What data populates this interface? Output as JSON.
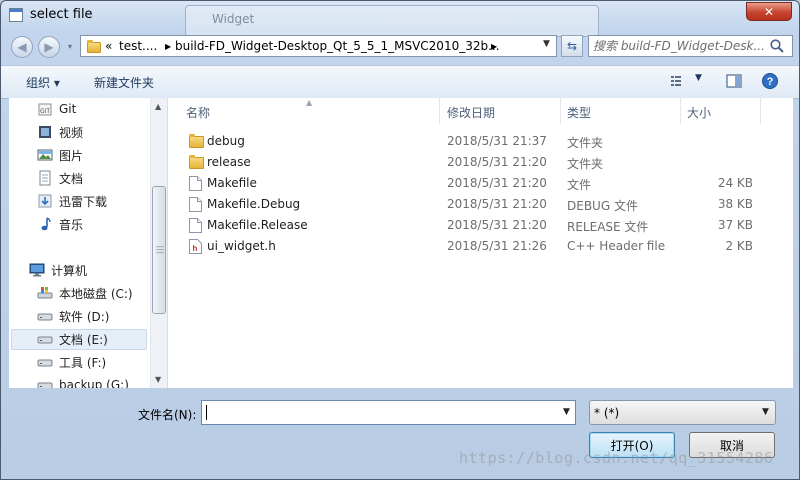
{
  "window": {
    "title": "select file",
    "background_window_title": "Widget"
  },
  "nav_buttons": {
    "back_glyph": "◀",
    "forward_glyph": "▶",
    "recent_glyph": "▾"
  },
  "address": {
    "prefix": "«",
    "crumbs": [
      {
        "label": "test...."
      },
      {
        "label": "build-FD_Widget-Desktop_Qt_5_5_1_MSVC2010_32b..."
      }
    ],
    "separator": "▶"
  },
  "search": {
    "placeholder": "搜索 build-FD_Widget-Desk..."
  },
  "toolbar": {
    "organize_label": "组织 ▾",
    "new_folder_label": "新建文件夹"
  },
  "sidebar": {
    "items": [
      {
        "label": "Git",
        "icon": "git-folder-icon"
      },
      {
        "label": "视频",
        "icon": "video-library-icon"
      },
      {
        "label": "图片",
        "icon": "picture-library-icon"
      },
      {
        "label": "文档",
        "icon": "document-library-icon"
      },
      {
        "label": "迅雷下载",
        "icon": "download-folder-icon"
      },
      {
        "label": "音乐",
        "icon": "music-library-icon"
      },
      {
        "label": "计算机",
        "icon": "computer-icon"
      },
      {
        "label": "本地磁盘 (C:)",
        "icon": "system-drive-icon"
      },
      {
        "label": "软件 (D:)",
        "icon": "drive-icon"
      },
      {
        "label": "文档 (E:)",
        "icon": "drive-icon",
        "selected": true
      },
      {
        "label": "工具 (F:)",
        "icon": "drive-icon"
      },
      {
        "label": "backup (G:)",
        "icon": "drive-icon"
      }
    ]
  },
  "columns": {
    "name": "名称",
    "date": "修改日期",
    "type": "类型",
    "size": "大小"
  },
  "files": [
    {
      "name": "debug",
      "date": "2018/5/31 21:37",
      "type": "文件夹",
      "size": "",
      "icon": "folder-icon"
    },
    {
      "name": "release",
      "date": "2018/5/31 21:20",
      "type": "文件夹",
      "size": "",
      "icon": "folder-icon"
    },
    {
      "name": "Makefile",
      "date": "2018/5/31 21:20",
      "type": "文件",
      "size": "24 KB",
      "icon": "file-icon"
    },
    {
      "name": "Makefile.Debug",
      "date": "2018/5/31 21:20",
      "type": "DEBUG 文件",
      "size": "38 KB",
      "icon": "file-icon"
    },
    {
      "name": "Makefile.Release",
      "date": "2018/5/31 21:20",
      "type": "RELEASE 文件",
      "size": "37 KB",
      "icon": "file-icon"
    },
    {
      "name": "ui_widget.h",
      "date": "2018/5/31 21:26",
      "type": "C++ Header file",
      "size": "2 KB",
      "icon": "header-file-icon"
    }
  ],
  "footer": {
    "filename_label": "文件名(N):",
    "filename_value": "",
    "filter_value": "* (*)",
    "open_label": "打开(O)",
    "cancel_label": "取消"
  },
  "watermark": "https://blog.csdn.net/qq_31554286"
}
